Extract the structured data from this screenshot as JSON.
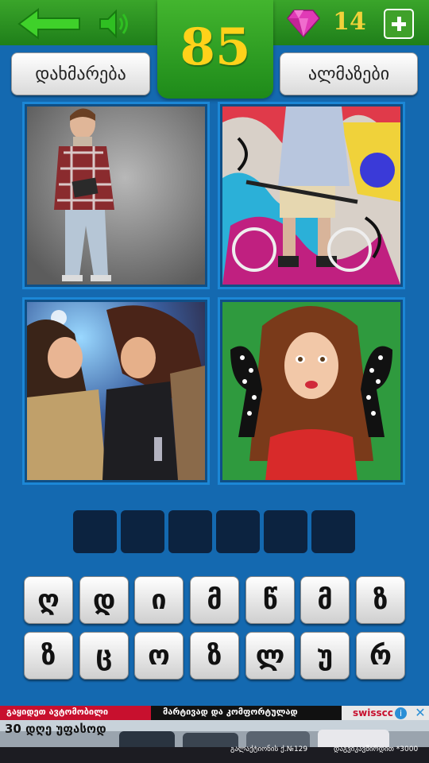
{
  "header": {
    "level": "85",
    "gem_count": "14",
    "icons": {
      "back": "back-arrow-icon",
      "sound": "speaker-icon",
      "gem": "diamond-icon",
      "plus": "plus-icon"
    },
    "colors": {
      "bar_green": "#2f9a24",
      "level_yellow": "#ffd21a",
      "background_blue": "#1469b0"
    }
  },
  "buttons": {
    "hint": "დახმარება",
    "gems": "ალმაზები"
  },
  "answer": {
    "slots": 6,
    "letters": [
      "",
      "",
      "",
      "",
      "",
      ""
    ]
  },
  "keyboard": {
    "row1": [
      "ღ",
      "დ",
      "ი",
      "მ",
      "წ",
      "მ",
      "ზ"
    ],
    "row2": [
      "ზ",
      "ც",
      "ო",
      "ზ",
      "ლ",
      "უ",
      "რ"
    ]
  },
  "ad": {
    "line1": "გაყიდეთ ავტომობილი",
    "line2": "მარტივად და კომფორტულად",
    "line3": "30 დღე უფასოდ",
    "line4": "გალაქტიონის ქ.№129",
    "line5": "დაგვიკავშირდით *3000",
    "brand": "swisscc"
  }
}
